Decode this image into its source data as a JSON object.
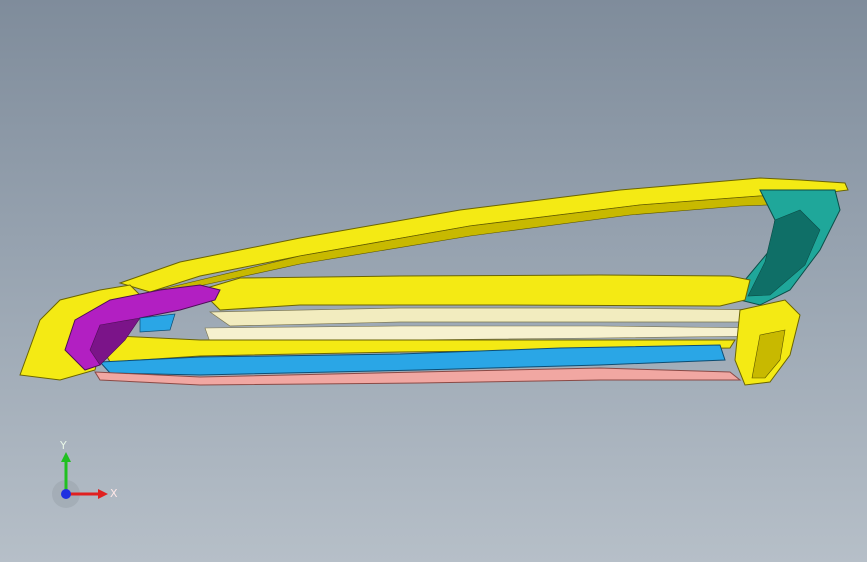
{
  "viewport": {
    "background_top": "#7f8c9b",
    "background_bottom": "#b6bfc8"
  },
  "model": {
    "description_icon": "car-door-frame-assembly",
    "part_colors": {
      "outer_frame": "#f4ea14",
      "outer_frame_shade": "#c8b900",
      "teal_reinforcement": "#1fa79a",
      "teal_shade": "#0f6f67",
      "magenta_bracket": "#b21fc2",
      "blue_panel": "#2aa6e6",
      "pink_sill": "#f1a7a2",
      "cream_strip": "#f2ecbf"
    }
  },
  "triad": {
    "x_label": "X",
    "y_label": "Y",
    "x_color": "#e02020",
    "y_color": "#20c020",
    "z_color": "#2030e0"
  }
}
